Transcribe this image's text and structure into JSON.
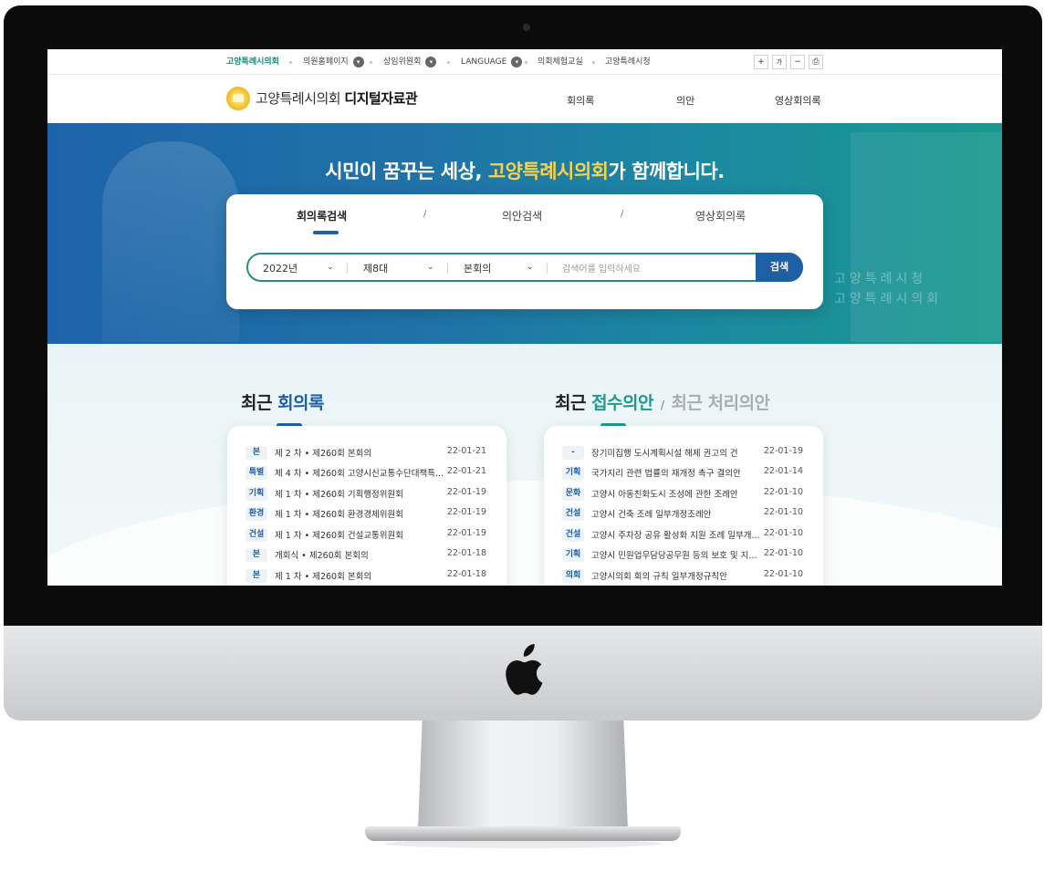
{
  "utility": {
    "items": [
      {
        "label": "고양특례시의회",
        "active": true,
        "dropdown": false
      },
      {
        "label": "의원홈페이지",
        "active": false,
        "dropdown": true
      },
      {
        "label": "상임위원회",
        "active": false,
        "dropdown": true
      },
      {
        "label": "LANGUAGE",
        "active": false,
        "dropdown": true
      },
      {
        "label": "의회체험교실",
        "active": false,
        "dropdown": false
      },
      {
        "label": "고양특례시청",
        "active": false,
        "dropdown": false
      }
    ],
    "zoom_in": "+",
    "font_label": "가",
    "zoom_out": "−",
    "print": "⎙"
  },
  "header": {
    "logo_prefix": "고양특례시의회",
    "logo_suffix": "디지털자료관",
    "nav": [
      "회의록",
      "의안",
      "영상회의록"
    ]
  },
  "hero": {
    "title_pre": "시민이 꿈꾸는 세상, ",
    "title_highlight": "고양특례시의회",
    "title_post": "가 함께합니다.",
    "sign_line1": "고양특례시청",
    "sign_line2": "고양특례시의회",
    "highlight_color": "#f8d349"
  },
  "search": {
    "tabs": [
      "회의록검색",
      "의안검색",
      "영상회의록"
    ],
    "separator": "/",
    "active_tab": 0,
    "year": "2022년",
    "term": "제8대",
    "session": "본회의",
    "placeholder": "검색어를 입력하세요",
    "button": "검색",
    "accent_color": "#1f5fa6"
  },
  "minutes": {
    "title_pre": "최근 ",
    "title_hl": "회의록",
    "rows": [
      {
        "tag": "본",
        "text": "제 2 차 • 제260회 본회의",
        "date": "22-01-21"
      },
      {
        "tag": "특별",
        "text": "제 4 차 • 제260회 고양시신교통수단대책특...",
        "date": "22-01-21"
      },
      {
        "tag": "기획",
        "text": "제 1 차 • 제260회 기획행정위원회",
        "date": "22-01-19"
      },
      {
        "tag": "환경",
        "text": "제 1 차 • 제260회 환경경제위원회",
        "date": "22-01-19"
      },
      {
        "tag": "건설",
        "text": "제 1 차 • 제260회 건설교통위원회",
        "date": "22-01-19"
      },
      {
        "tag": "본",
        "text": "개회식 • 제260회 본회의",
        "date": "22-01-18"
      },
      {
        "tag": "본",
        "text": "제 1 차 • 제260회 본회의",
        "date": "22-01-18"
      }
    ]
  },
  "bills": {
    "title_pre": "최근 ",
    "title_hl": "접수의안",
    "title_sep": "/",
    "title_alt": "최근 처리의안",
    "rows": [
      {
        "tag": "-",
        "text": "장기미집행 도시계획시설 해제 권고의 건",
        "date": "22-01-19"
      },
      {
        "tag": "기획",
        "text": "국가지리 관련 법률의 재개정 촉구 결의안",
        "date": "22-01-14"
      },
      {
        "tag": "문화",
        "text": "고양시 아동친화도시 조성에 관한 조례안",
        "date": "22-01-10"
      },
      {
        "tag": "건설",
        "text": "고양시 건축 조례 일부개정조례안",
        "date": "22-01-10"
      },
      {
        "tag": "건설",
        "text": "고양시 주차장 공유 활성화 지원 조례 일부개...",
        "date": "22-01-10"
      },
      {
        "tag": "기획",
        "text": "고양시 민원업무담당공무원 등의 보호 및 지...",
        "date": "22-01-10"
      },
      {
        "tag": "의회",
        "text": "고양시의회 회의 규칙 일부개정규칙안",
        "date": "22-01-10"
      }
    ]
  }
}
